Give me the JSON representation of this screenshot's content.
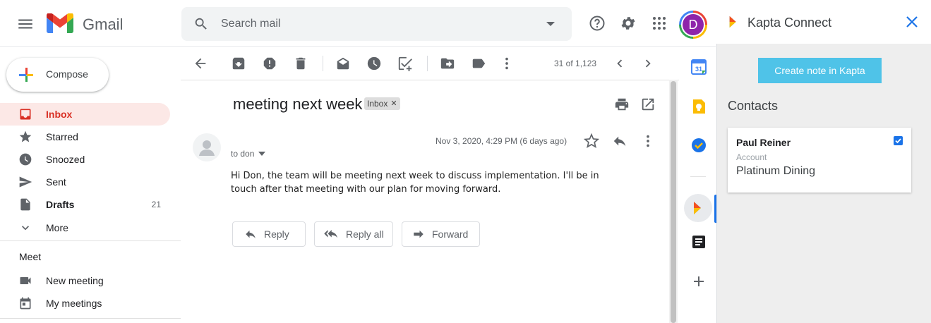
{
  "app": {
    "name": "Gmail"
  },
  "search": {
    "placeholder": "Search mail"
  },
  "header": {
    "avatar_letter": "D"
  },
  "nav": {
    "compose_label": "Compose",
    "items": [
      {
        "label": "Inbox",
        "icon": "inbox-icon",
        "active": true
      },
      {
        "label": "Starred",
        "icon": "star-icon"
      },
      {
        "label": "Snoozed",
        "icon": "clock-icon"
      },
      {
        "label": "Sent",
        "icon": "send-icon"
      },
      {
        "label": "Drafts",
        "icon": "draft-icon",
        "count": "21"
      },
      {
        "label": "More",
        "icon": "chevron-down-icon"
      }
    ],
    "meet": {
      "heading": "Meet",
      "new_meeting": "New meeting",
      "my_meetings": "My meetings"
    }
  },
  "toolbar": {
    "pager": "31 of 1,123"
  },
  "message": {
    "subject": "meeting next week",
    "label": "Inbox",
    "to": "to don",
    "date": "Nov 3, 2020, 4:29 PM (6 days ago)",
    "body": "Hi Don, the team will be meeting next week to discuss implementation. I'll be in touch after that meeting with our plan for moving forward.",
    "actions": {
      "reply": "Reply",
      "reply_all": "Reply all",
      "forward": "Forward"
    }
  },
  "kapta": {
    "title": "Kapta Connect",
    "create_button": "Create note in Kapta",
    "contacts_heading": "Contacts",
    "contact": {
      "name": "Paul Reiner",
      "account_label": "Account",
      "account_value": "Platinum Dining",
      "checked": true
    },
    "accent": "#4fc3e8"
  },
  "colors": {
    "inbox_active_bg": "#fce8e6",
    "inbox_active_text": "#d93025",
    "link_blue": "#1a73e8"
  }
}
